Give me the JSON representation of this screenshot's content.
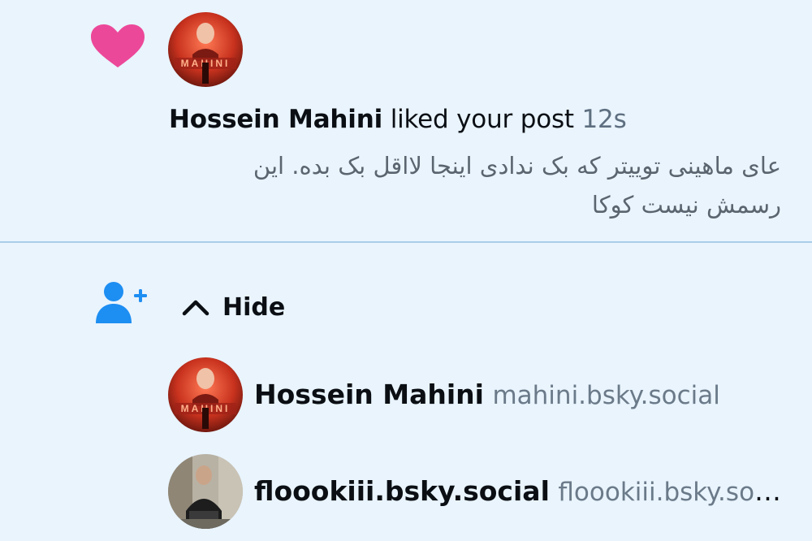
{
  "notification": {
    "type_icon": "heart-icon",
    "heart_color": "#ec4899",
    "actor_name": "Hossein Mahini",
    "action": "liked your post",
    "time": "12s",
    "post_text": "عای ماهینی توییتر که بک ندادی اینجا لااقل بک بده. این رسمش نیست کوکا"
  },
  "follow_group": {
    "icon": "person-add-icon",
    "icon_color": "#1d8ef2",
    "toggle_label": "Hide",
    "toggle_icon": "chevron-up-icon",
    "users": [
      {
        "name": "Hossein Mahini",
        "handle": "mahini.bsky.social"
      },
      {
        "name": "floookiii.bsky.social",
        "handle": "floookiii.bsky.social"
      }
    ]
  }
}
